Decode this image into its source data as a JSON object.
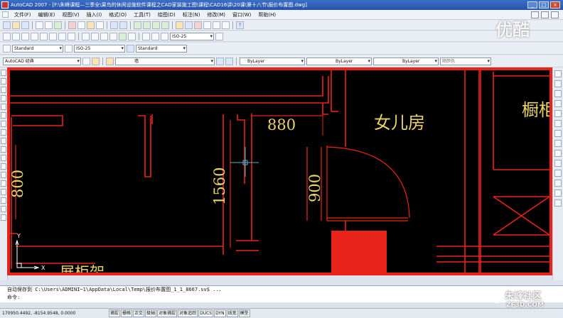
{
  "window": {
    "title": "AutoCAD 2007 - [F:\\朱峰课程—三季全\\果鸟的休闲设施软件课程之CAD家装施工图\\课程\\CAD16讲\\20课\\第十八节\\报价布置图.dwg]"
  },
  "menu": [
    "文件(F)",
    "编辑(E)",
    "视图(V)",
    "插入(I)",
    "格式(O)",
    "工具(T)",
    "绘图(D)",
    "标注(N)",
    "修改(M)",
    "窗口(W)",
    "帮助(H)"
  ],
  "toolbars": {
    "dim_style_1": "ISO-25",
    "text_style": "Standard",
    "dim_style_2": "ISO-25",
    "table_style": "Standard",
    "workspace": "AutoCAD 经典",
    "layer": "墙",
    "color": "ByLayer",
    "linetype": "ByLayer",
    "lineweight": "ByLayer",
    "plotstyle": "随颜色"
  },
  "drawing": {
    "room_label": "女儿房",
    "room_label_cut": "橱柜",
    "dim_880": "880",
    "dim_1560": "1560",
    "dim_900": "900",
    "dim_800": "800",
    "bottom_label_cut": "展柜架",
    "ucs_x": "X",
    "ucs_y": "Y"
  },
  "command_line": {
    "line1": "自动保存到 C:\\Users\\ADMINI~1\\AppData\\Local\\Temp\\报价布置图_1_1_8667.sv$ ...",
    "line2": "命令:"
  },
  "status": {
    "coords": "170950.4492, -8154.9548, 0.0000",
    "buttons": [
      "捕捉",
      "栅格",
      "正交",
      "极轴",
      "对象捕捉",
      "对象追踪",
      "DUCS",
      "DYN",
      "线宽",
      "模型"
    ]
  },
  "watermarks": {
    "top_right": "优酷",
    "bottom_right": "朱峰社区",
    "bottom_right_url": "ZF3D.COM"
  }
}
